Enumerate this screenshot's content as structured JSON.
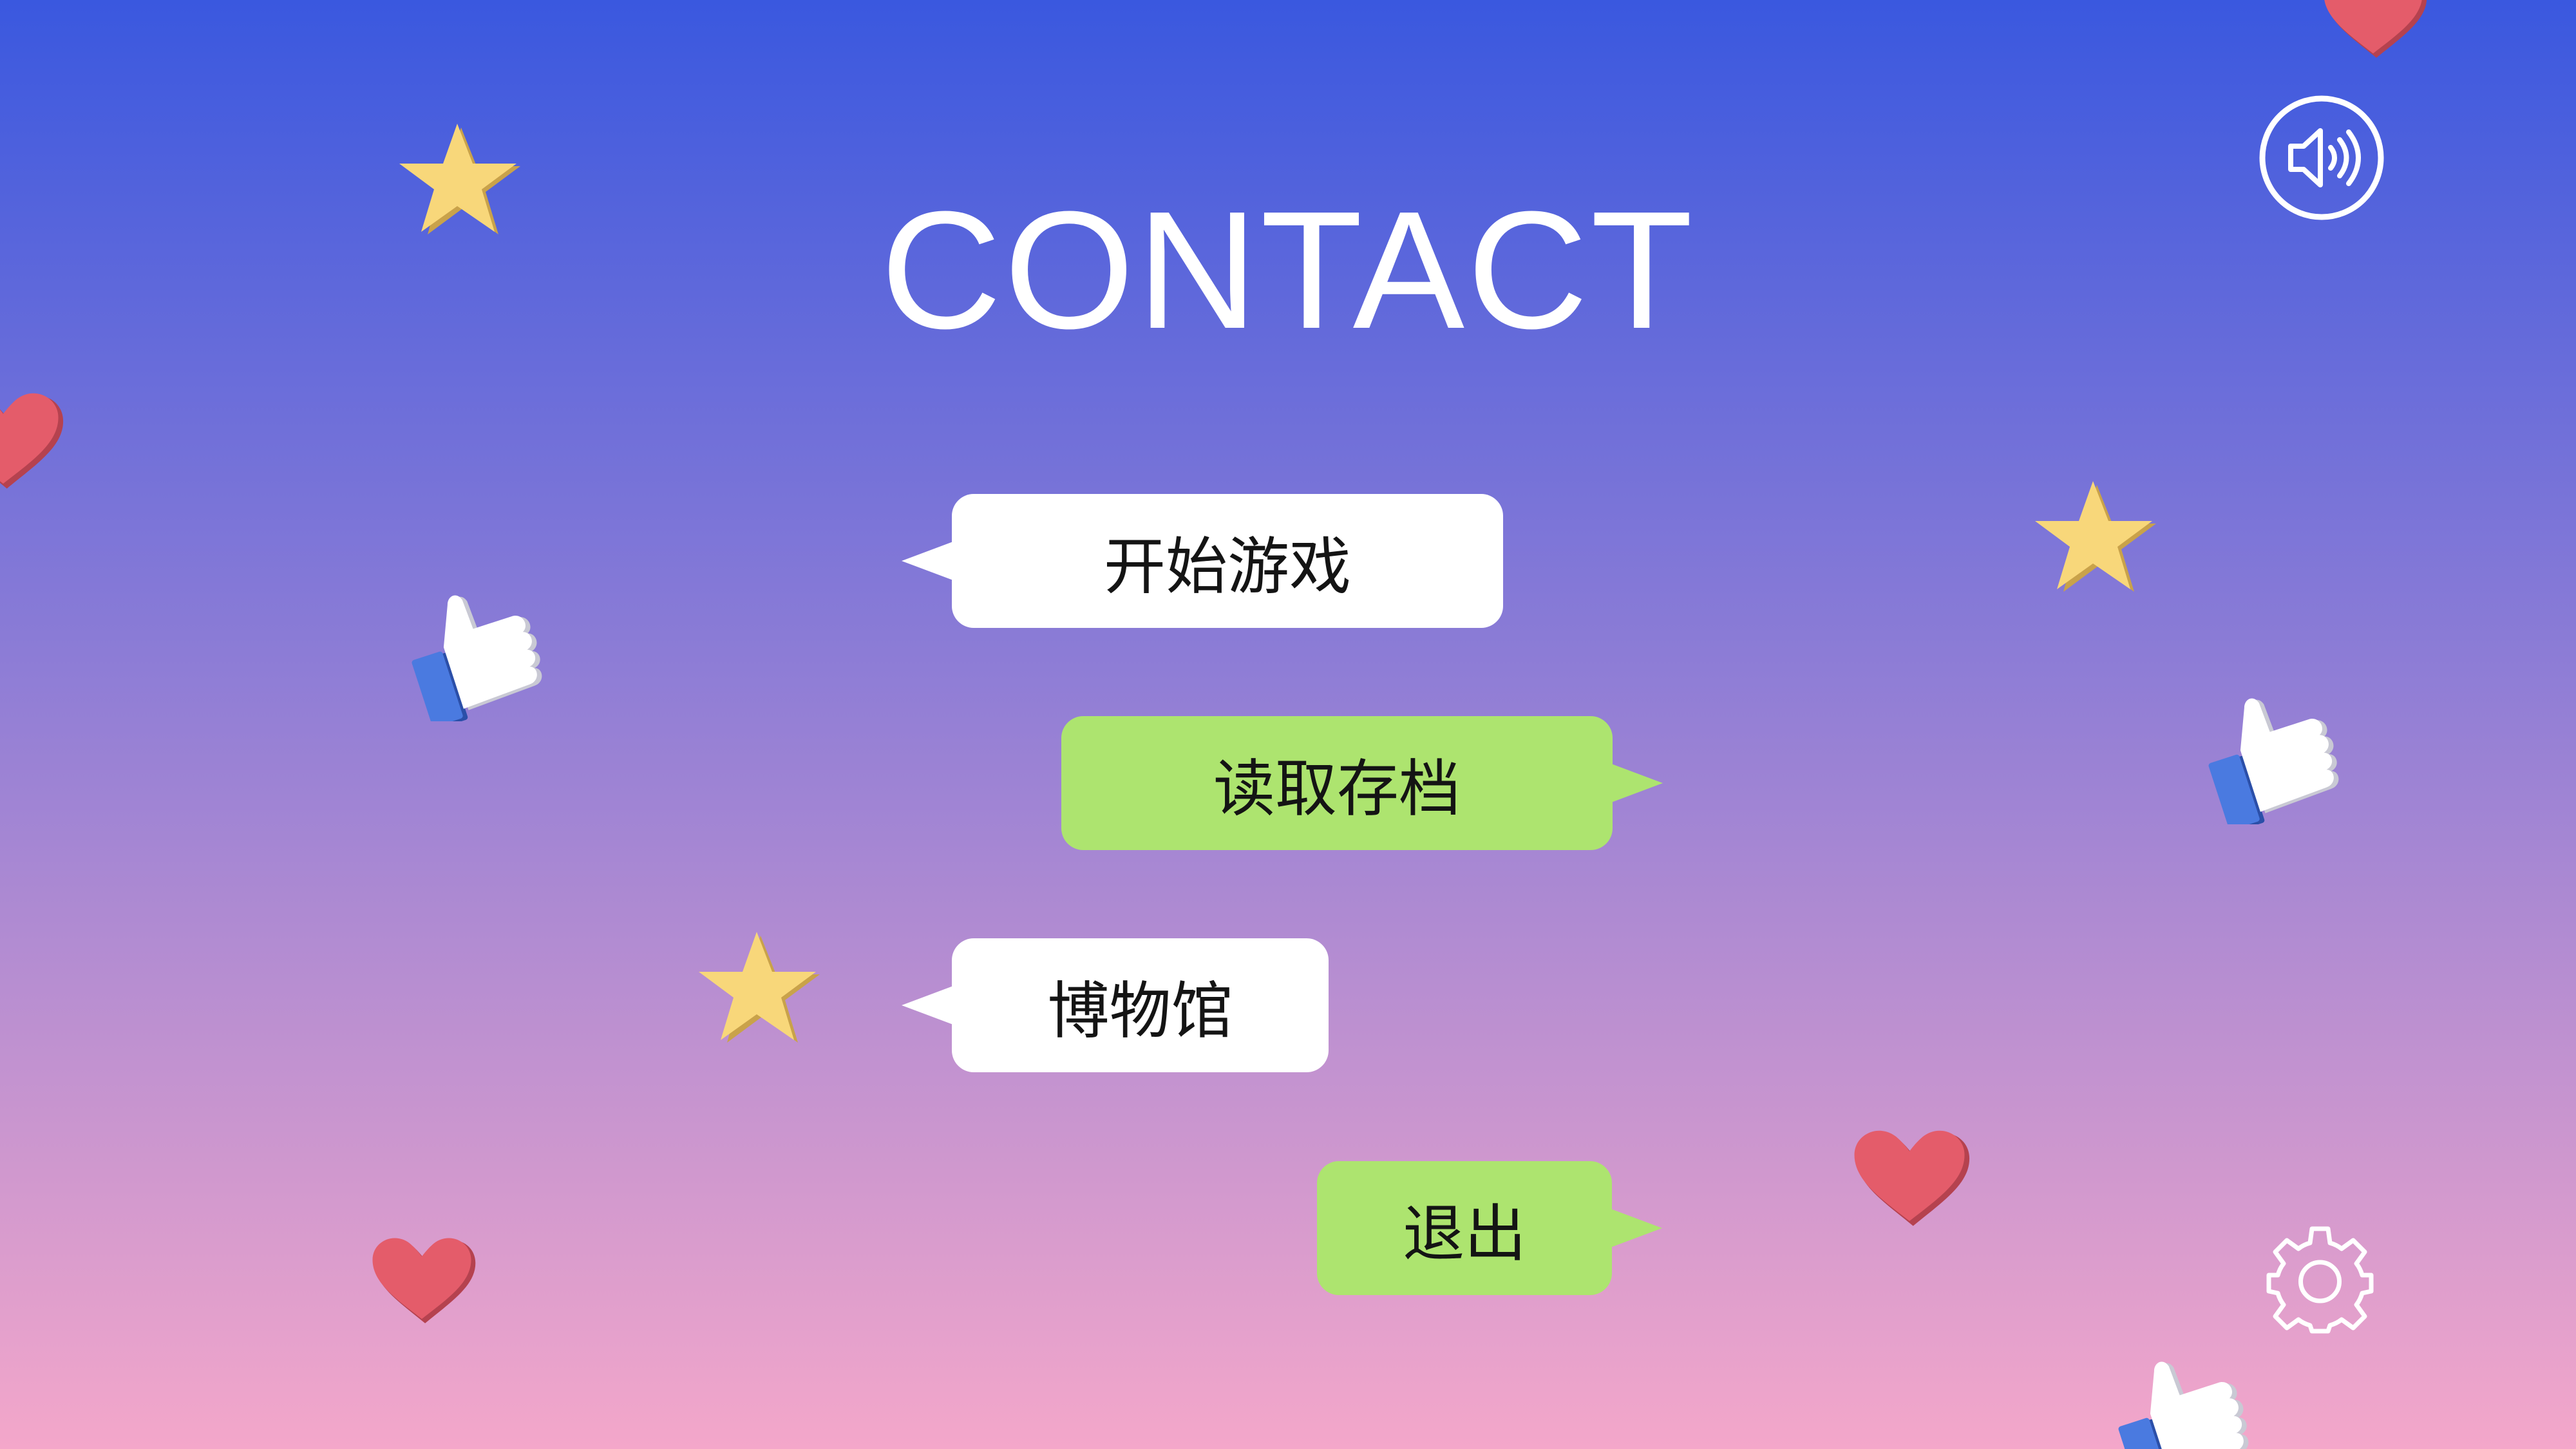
{
  "title": "CONTACT",
  "menu": {
    "start_label": "开始游戏",
    "load_label": "读取存档",
    "museum_label": "博物馆",
    "exit_label": "退出"
  },
  "icons": {
    "sound": "speaker-icon",
    "settings": "gear-icon"
  },
  "colors": {
    "gradient_top": "#3a58df",
    "gradient_mid": "#8c7cd6",
    "gradient_bottom": "#f4a7ca",
    "bubble_white": "#ffffff",
    "bubble_green": "#ade46f",
    "star": "#f8d77a",
    "heart": "#e45c6a",
    "thumb_blue": "#4a7ae0"
  }
}
